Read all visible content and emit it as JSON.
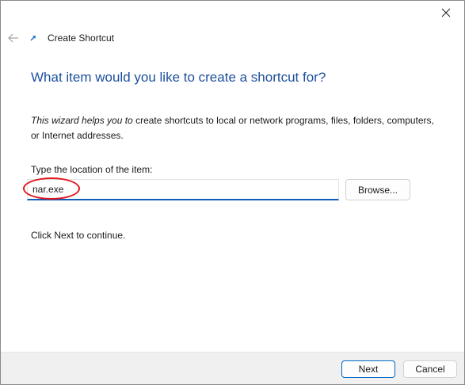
{
  "window": {
    "title": "Create Shortcut"
  },
  "icons": {
    "close": "close-icon",
    "back": "back-arrow-icon",
    "shortcut": "shortcut-arrow-icon"
  },
  "content": {
    "heading": "What item would you like to create a shortcut for?",
    "intro_italic": "This wizard helps you to",
    "intro_rest": " create shortcuts to local or network programs, files, folders, computers, or Internet addresses.",
    "location_label": "Type the location of the item:",
    "location_value": "nar.exe",
    "browse_label": "Browse...",
    "continue_text": "Click Next to continue."
  },
  "footer": {
    "next_label": "Next",
    "cancel_label": "Cancel"
  },
  "colors": {
    "heading": "#1c4f9c",
    "input_focus_underline": "#0f5fb8",
    "annotation_ellipse": "#e0161b",
    "footer_background": "#f0f0f0",
    "default_button_border": "#0067c0"
  }
}
